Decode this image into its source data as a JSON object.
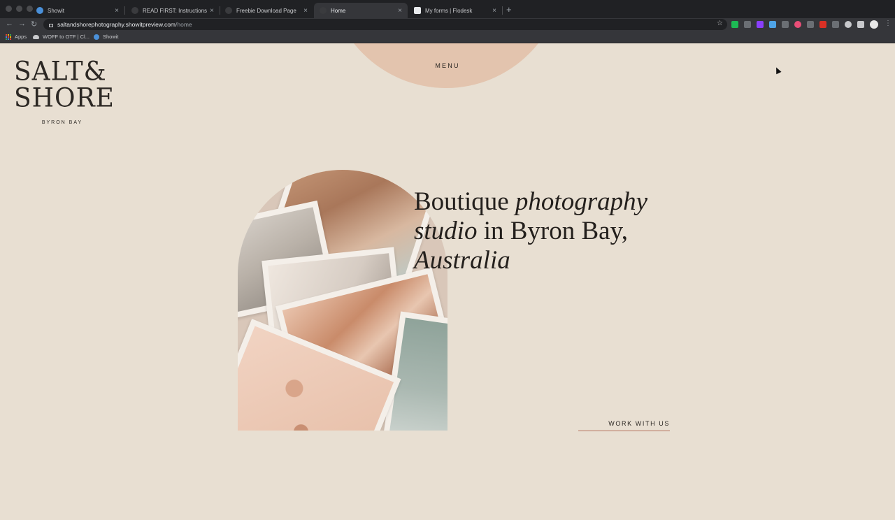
{
  "browser": {
    "tabs": [
      {
        "title": "Showit",
        "fav_color": "#4a90d9",
        "active": false
      },
      {
        "title": "READ FIRST: Instructions",
        "fav_color": "#3a3b3e",
        "active": false
      },
      {
        "title": "Freebie Download Page",
        "fav_color": "#3a3b3e",
        "active": false
      },
      {
        "title": "Home",
        "fav_color": "#3a3b3e",
        "active": true
      },
      {
        "title": "My forms | Flodesk",
        "fav_color": "#e8eaed",
        "active": false
      }
    ],
    "tab_close_glyph": "×",
    "new_tab_glyph": "+",
    "url_host": "saltandshorephotography.showitpreview.com",
    "url_path": "/home",
    "nav": {
      "back": "←",
      "forward": "→",
      "reload": "↻"
    },
    "star_glyph": "☆",
    "kebab_glyph": "⋮",
    "bookmarks": [
      {
        "label": "Apps",
        "icon": "apps-grid-icon"
      },
      {
        "label": "WOFF to OTF | Cl...",
        "icon": "cloud-icon"
      },
      {
        "label": "Showit",
        "icon": "showit-icon"
      }
    ],
    "extension_colors": [
      "#1db954",
      "#6b6f74",
      "#4ea3e6",
      "#8a3ffc",
      "#6b6f74",
      "#e94e77",
      "#6b6f74",
      "#d93025",
      "#6b6f74",
      "#c8c9cc",
      "#c8c9cc"
    ]
  },
  "site": {
    "menu_label": "MENU",
    "logo_line1": "SALT&",
    "logo_line2": "SHORE",
    "logo_sub": "BYRON BAY",
    "headline": {
      "part1": "Boutique ",
      "part2_italic": "photography",
      "part3_italic": "studio",
      "part4": " in Byron Bay,",
      "part5_italic": "Australia"
    },
    "cta_label": "WORK WITH US",
    "colors": {
      "background": "#e8dfd2",
      "menu_circle": "#e3c4ae",
      "text": "#231f1c",
      "cta_underline": "#b5735d"
    }
  }
}
